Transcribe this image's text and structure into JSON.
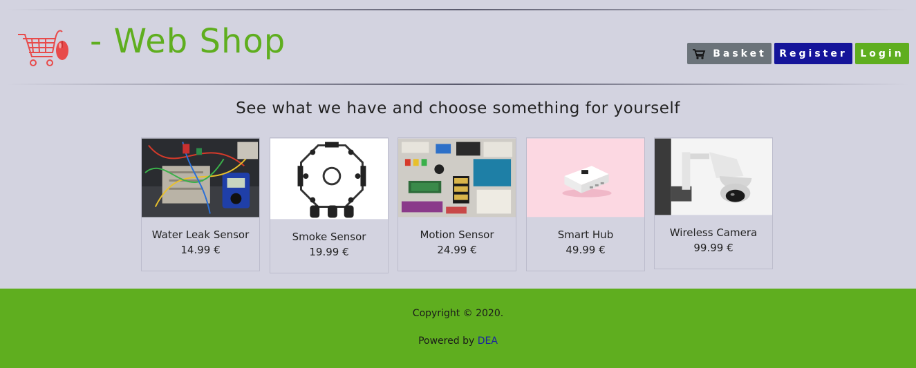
{
  "header": {
    "brand": "- Web Shop",
    "logo_icon": "shopping-cart-with-mouse-icon"
  },
  "nav": {
    "basket_label": "Basket",
    "register_label": "Register",
    "login_label": "Login"
  },
  "main": {
    "headline": "See what we have and choose something for yourself",
    "products": [
      {
        "name": "Water Leak Sensor",
        "price": "14.99 €",
        "image": "electronics-breadboard-photo"
      },
      {
        "name": "Smoke Sensor",
        "price": "19.99 €",
        "image": "circuit-board-pcb-photo"
      },
      {
        "name": "Motion Sensor",
        "price": "24.99 €",
        "image": "electronic-components-flatlay-photo"
      },
      {
        "name": "Smart Hub",
        "price": "49.99 €",
        "image": "white-hub-device-photo"
      },
      {
        "name": "Wireless Camera",
        "price": "99.99 €",
        "image": "security-camera-photo"
      }
    ]
  },
  "footer": {
    "copyright": "Copyright © 2020.",
    "powered_prefix": "Powered by ",
    "powered_link": "DEA"
  },
  "colors": {
    "accent_green": "#5fae1f",
    "register_blue": "#15149a",
    "basket_gray": "#6b737a",
    "background": "#d3d3e0"
  }
}
